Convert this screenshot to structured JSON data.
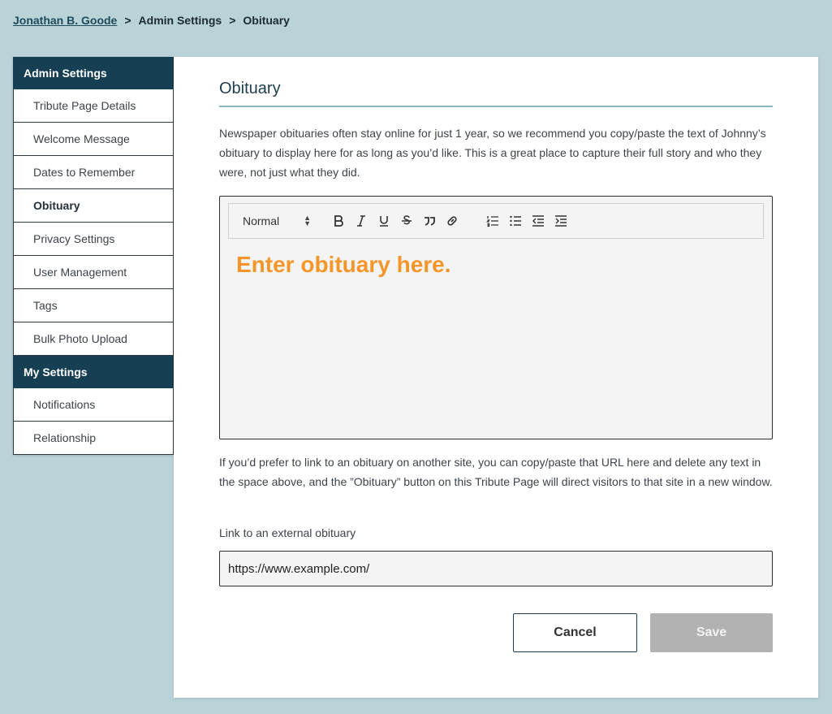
{
  "breadcrumb": {
    "user": "Jonathan B. Goode",
    "sep": ">",
    "section": "Admin Settings",
    "page": "Obituary"
  },
  "sidebar": {
    "admin_heading": "Admin Settings",
    "admin_items": [
      {
        "label": "Tribute Page Details"
      },
      {
        "label": "Welcome Message"
      },
      {
        "label": "Dates to Remember"
      },
      {
        "label": "Obituary",
        "active": true
      },
      {
        "label": "Privacy Settings"
      },
      {
        "label": "User Management"
      },
      {
        "label": "Tags"
      },
      {
        "label": "Bulk Photo Upload"
      }
    ],
    "my_heading": "My Settings",
    "my_items": [
      {
        "label": "Notifications"
      },
      {
        "label": "Relationship"
      }
    ]
  },
  "main": {
    "title": "Obituary",
    "intro": "Newspaper obituaries often stay online for just 1 year, so we recommend you copy/paste the text of Johnny’s obituary to display here for as long as you’d like. This is a great place to capture their full story and who they were, not just what they did.",
    "editor": {
      "format_select": "Normal",
      "placeholder": "Enter obituary here.",
      "placeholder_color": "#f5962a",
      "tools": [
        "bold-icon",
        "italic-icon",
        "underline-icon",
        "strikethrough-icon",
        "blockquote-icon",
        "link-icon",
        "ordered-list-icon",
        "bullet-list-icon",
        "outdent-icon",
        "indent-icon"
      ]
    },
    "link_note": "If you’d prefer to link to an obituary on another site, you can copy/paste that URL here and delete any text in the space above, and the ”Obituary” button on this Tribute Page will direct visitors to that site in a new window.",
    "link_label": "Link to an external obituary",
    "link_value": "https://www.example.com/",
    "cancel_label": "Cancel",
    "save_label": "Save"
  },
  "colors": {
    "background": "#b9d3d9",
    "sidebar_heading": "#173f54",
    "save_disabled": "#b2b2b2"
  }
}
